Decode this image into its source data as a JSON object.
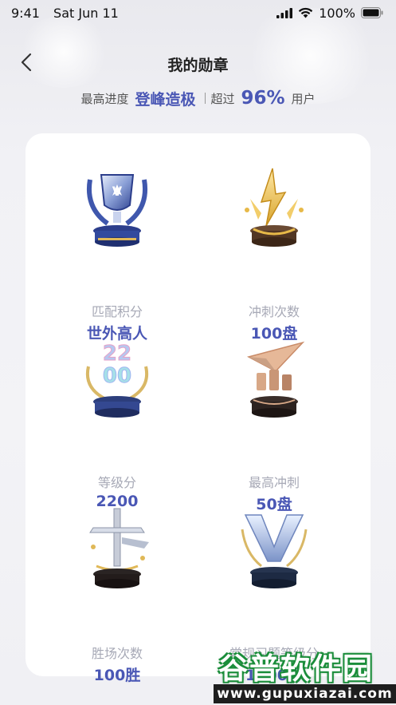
{
  "status_bar": {
    "time": "9:41",
    "date": "Sat Jun 11",
    "battery": "100%"
  },
  "header": {
    "title": "我的勋章",
    "back_icon": "chevron-left-icon"
  },
  "progress": {
    "label": "最高进度",
    "level": "登峰造极",
    "exceed_label": "超过",
    "percent": "96%",
    "users_label": "用户"
  },
  "badges": [
    {
      "name": "匹配积分",
      "value": "世外高人",
      "icon": "silver-trophy-icon"
    },
    {
      "name": "冲刺次数",
      "value": "100盘",
      "icon": "gold-lightning-icon"
    },
    {
      "name": "等级分",
      "value": "2200",
      "icon": "number-2200-laurel-icon"
    },
    {
      "name": "最高冲刺",
      "value": "50盘",
      "icon": "paper-plane-icon"
    },
    {
      "name": "胜场次数",
      "value": "100胜",
      "icon": "sword-icon"
    },
    {
      "name": "常规习题等级分",
      "value": "1500分",
      "icon": "silver-v-wings-icon"
    }
  ],
  "watermark": {
    "text": "谷普软件园",
    "url": "www.gupuxiazai.com"
  },
  "colors": {
    "accent": "#4a57b5",
    "muted": "#a7a9b6",
    "card_bg": "#ffffff",
    "page_bg": "#f2f2f5"
  }
}
